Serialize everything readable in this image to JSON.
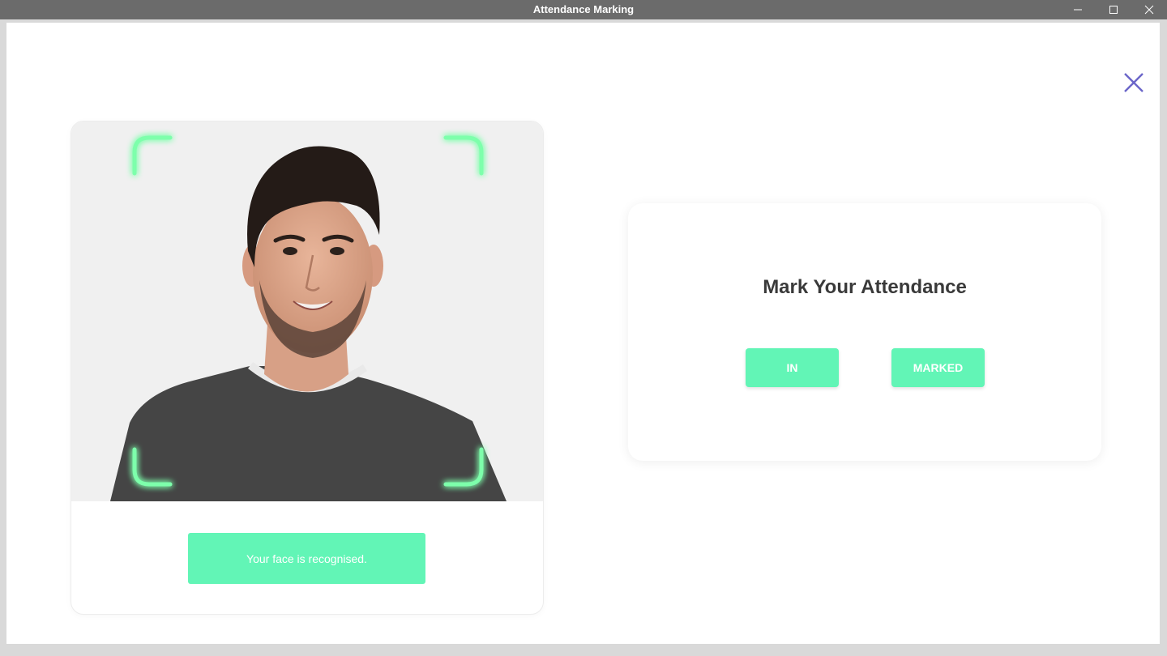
{
  "window": {
    "title": "Attendance Marking"
  },
  "face_panel": {
    "status_message": "Your face is recognised.",
    "frame_color": "#4dff8e"
  },
  "attendance_panel": {
    "heading": "Mark Your Attendance",
    "in_button_label": "IN",
    "marked_button_label": "MARKED"
  },
  "colors": {
    "accent": "#62f5b6",
    "close_icon": "#6b66c9",
    "titlebar": "#6b6b6b"
  }
}
